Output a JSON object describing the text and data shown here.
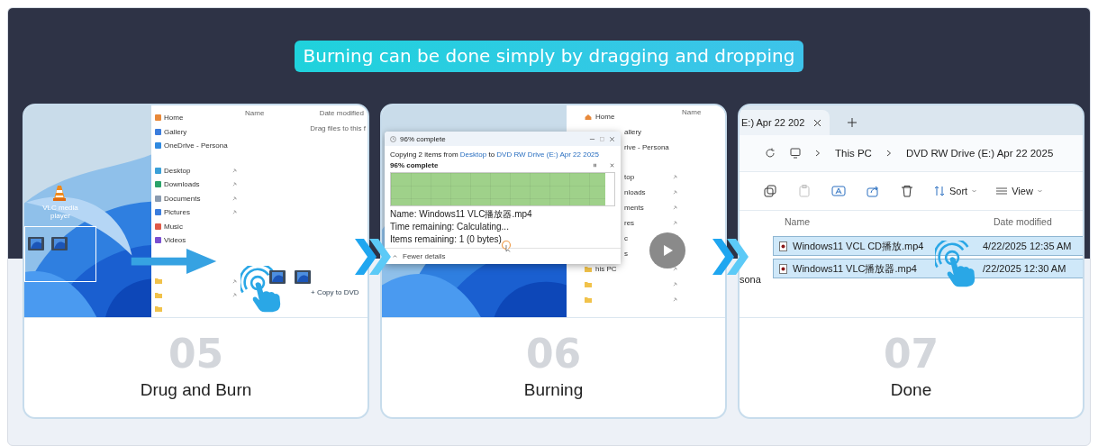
{
  "headline": "Burning can be done simply by dragging and dropping",
  "steps": [
    {
      "number": "05",
      "label": "Drug and Burn",
      "screen": {
        "kind": "drag",
        "desktop_icon_label": "VLC media player",
        "columns": [
          "Name",
          "Date modified"
        ],
        "hint": "Drag files to this f",
        "drop_hint": "+ Copy to DVD",
        "nav_items": [
          {
            "kind": "place",
            "label": "Home",
            "pinned": false
          },
          {
            "kind": "place",
            "label": "Gallery",
            "pinned": false
          },
          {
            "kind": "place",
            "label": "OneDrive - Persona",
            "pinned": false
          },
          {
            "kind": "place",
            "label": "Desktop",
            "pinned": true
          },
          {
            "kind": "place",
            "label": "Downloads",
            "pinned": true
          },
          {
            "kind": "place",
            "label": "Documents",
            "pinned": true
          },
          {
            "kind": "place",
            "label": "Pictures",
            "pinned": true
          },
          {
            "kind": "place",
            "label": "Music",
            "pinned": false
          },
          {
            "kind": "place",
            "label": "Videos",
            "pinned": false
          },
          {
            "kind": "folder",
            "pinned": true
          },
          {
            "kind": "folder",
            "pinned": true
          },
          {
            "kind": "folder",
            "pinned": false
          }
        ]
      }
    },
    {
      "number": "06",
      "label": "Burning",
      "screen": {
        "kind": "copy",
        "column": "Name",
        "nav_items": [
          {
            "label": "Home",
            "show_icon": true,
            "pinned": false
          },
          {
            "label": "allery",
            "show_icon": false,
            "pinned": false
          },
          {
            "label": "rive - Persona",
            "show_icon": false,
            "pinned": false
          },
          {
            "label": "top",
            "show_icon": false,
            "pinned": true
          },
          {
            "label": "nloads",
            "show_icon": false,
            "pinned": true
          },
          {
            "label": "ments",
            "show_icon": false,
            "pinned": true
          },
          {
            "label": "res",
            "show_icon": false,
            "pinned": true
          },
          {
            "label": "c",
            "show_icon": false
          },
          {
            "label": "s",
            "show_icon": false
          },
          {
            "label": "his PC",
            "show_icon": true,
            "pinned": true
          },
          {
            "show_icon": true,
            "pinned": true
          },
          {
            "show_icon": true,
            "pinned": true
          }
        ],
        "dialog": {
          "title": "96% complete",
          "summary_start": "Copying 2 items from",
          "source": "Desktop",
          "summary_middle": "to",
          "destination": "DVD RW Drive (E:) Apr 22 2025",
          "heading": "96% complete",
          "level": 0.96,
          "details": [
            "Name: Windows11 VLC播放器.mp4",
            "Time remaining: Calculating...",
            "Items remaining: 1 (0 bytes)"
          ],
          "toggle": "Fewer details"
        }
      }
    },
    {
      "number": "07",
      "label": "Done",
      "screen": {
        "kind": "explorer",
        "tab": "E:) Apr 22 202",
        "breadcrumb": [
          "This PC",
          "DVD RW Drive (E:) Apr 22 2025"
        ],
        "icon_buttons": [
          {
            "disabled": false
          },
          {
            "disabled": true
          },
          {
            "disabled": false
          },
          {
            "disabled": false
          },
          {
            "disabled": false
          }
        ],
        "sort": "Sort",
        "view": "View",
        "columns": [
          "Name",
          "Date modified"
        ],
        "side_label": "sona",
        "rows": [
          {
            "name": "Windows11 VCL CD播放.mp4",
            "date": "4/22/2025 12:35 AM",
            "selected": true
          },
          {
            "name": "Windows11 VLC播放器.mp4",
            "date": "/22/2025 12:30 AM",
            "selected": true
          }
        ]
      }
    }
  ]
}
